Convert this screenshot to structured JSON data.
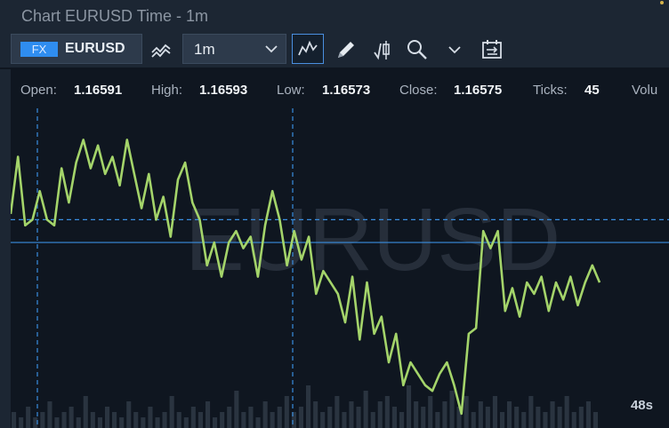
{
  "window": {
    "title": "Chart EURUSD Time - 1m"
  },
  "toolbar": {
    "asset_class_badge": "FX",
    "symbol": "EURUSD",
    "interval": "1m",
    "icons": [
      "chart-type-icon",
      "chevron-down-icon",
      "line-chart-icon",
      "pencil-icon",
      "candlestick-icon",
      "search-icon",
      "chevron-down-icon",
      "calendar-range-icon"
    ]
  },
  "ohlc": {
    "open_label": "Open:",
    "open_value": "1.16591",
    "high_label": "High:",
    "high_value": "1.16593",
    "low_label": "Low:",
    "low_value": "1.16573",
    "close_label": "Close:",
    "close_value": "1.16575",
    "ticks_label": "Ticks:",
    "ticks_value": "45",
    "volume_label": "Volu"
  },
  "chart": {
    "watermark": "EURUSD",
    "countdown": "48s",
    "colors": {
      "background": "#0f1620",
      "line": "#a4d46a",
      "crosshair": "#3a8ee0",
      "volume": "#2a3440",
      "watermark": "#3a4350"
    }
  },
  "chart_data": {
    "type": "line",
    "series": [
      {
        "values": [
          1.16578,
          1.16588,
          1.16576,
          1.16577,
          1.16582,
          1.16577,
          1.16576,
          1.16586,
          1.1658,
          1.16587,
          1.16591,
          1.16586,
          1.1659,
          1.16585,
          1.16588,
          1.16583,
          1.16591,
          1.16585,
          1.16579,
          1.16585,
          1.16577,
          1.16581,
          1.16574,
          1.16584,
          1.16587,
          1.1658,
          1.16577,
          1.16569,
          1.16573,
          1.16567,
          1.16573,
          1.16575,
          1.16572,
          1.16574,
          1.16567,
          1.16576,
          1.16582,
          1.16577,
          1.16569,
          1.16575,
          1.1657,
          1.16574,
          1.16564,
          1.16568,
          1.16566,
          1.16564,
          1.16559,
          1.16567,
          1.16556,
          1.16566,
          1.16557,
          1.1656,
          1.16552,
          1.16557,
          1.16548,
          1.16552,
          1.1655,
          1.16548,
          1.16547,
          1.1655,
          1.16552,
          1.16548,
          1.16543,
          1.16557,
          1.16558,
          1.16575,
          1.16572,
          1.16575,
          1.16561,
          1.16565,
          1.1656,
          1.16566,
          1.16564,
          1.16567,
          1.16561,
          1.16566,
          1.16563,
          1.16567,
          1.16562,
          1.16566,
          1.16569,
          1.16566
        ]
      }
    ],
    "crosshair_price_lines": [
      1.16577,
      1.16573
    ],
    "volume_values": [
      3,
      2,
      4,
      2,
      3,
      5,
      2,
      3,
      4,
      2,
      6,
      3,
      2,
      4,
      3,
      2,
      5,
      3,
      2,
      4,
      2,
      3,
      6,
      3,
      2,
      4,
      3,
      5,
      2,
      3,
      4,
      7,
      3,
      4,
      2,
      5,
      3,
      4,
      6,
      3,
      4,
      8,
      5,
      3,
      4,
      6,
      3,
      5,
      4,
      7,
      3,
      5,
      6,
      4,
      3,
      8,
      5,
      4,
      6,
      3,
      5,
      7,
      4,
      6,
      3,
      5,
      4,
      6,
      3,
      5,
      4,
      3,
      6,
      4,
      3,
      5,
      4,
      6,
      3,
      4,
      5,
      3
    ]
  }
}
